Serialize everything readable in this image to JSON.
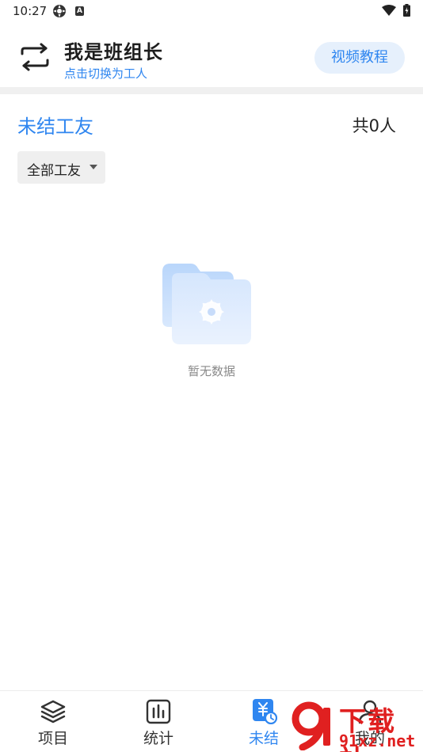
{
  "status_bar": {
    "time": "10:27",
    "icons": [
      "settings-gear-icon",
      "a-badge-icon",
      "wifi-icon",
      "battery-icon"
    ],
    "badge_letter": "A"
  },
  "header": {
    "role_title": "我是班组长",
    "switch_hint": "点击切换为工人",
    "video_tutorial_label": "视频教程",
    "switch_icon": "swap-arrows-icon"
  },
  "section": {
    "title": "未结工友",
    "count_text": "共0人"
  },
  "filter": {
    "selected": "全部工友",
    "icon": "caret-down-icon"
  },
  "empty_state": {
    "text": "暂无数据",
    "icon": "empty-folder-icon"
  },
  "bottom_nav": {
    "active_index": 2,
    "items": [
      {
        "label": "项目",
        "icon": "layers-icon"
      },
      {
        "label": "统计",
        "icon": "bar-chart-icon"
      },
      {
        "label": "未结",
        "icon": "yen-clock-icon"
      },
      {
        "label": "我的",
        "icon": "user-icon"
      }
    ]
  },
  "watermark": {
    "top": "下载站",
    "bottom": "91xz.net",
    "logo_number": "9"
  },
  "colors": {
    "accent": "#2f86f0",
    "accent_bg": "#e6f0fc",
    "divider": "#f0f0f0",
    "watermark": "#e02020"
  }
}
